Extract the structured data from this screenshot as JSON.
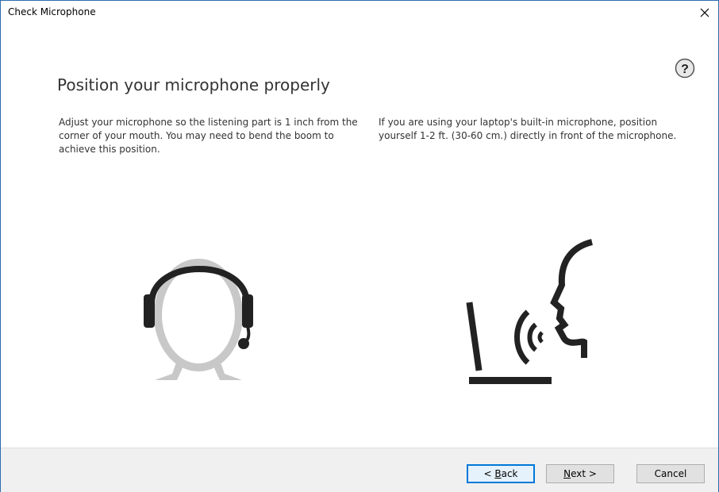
{
  "window": {
    "title": "Check Microphone",
    "close_glyph": "✕"
  },
  "help": {
    "glyph": "?",
    "icon": "help-icon"
  },
  "content": {
    "heading": "Position your microphone properly",
    "left_text": "Adjust your microphone so the listening part is 1 inch from the corner of your mouth. You may need to bend the boom to achieve this position.",
    "right_text": "If you are using your laptop's built-in microphone, position yourself 1-2 ft. (30-60 cm.) directly in front of the microphone."
  },
  "illustrations": {
    "left_icon": "headset-person-icon",
    "right_icon": "laptop-speaking-icon"
  },
  "buttons": {
    "back": {
      "prefix": "< ",
      "accel": "B",
      "rest": "ack"
    },
    "next": {
      "accel": "N",
      "rest": "ext >"
    },
    "cancel": "Cancel"
  },
  "colors": {
    "accent": "#0078d7",
    "icon_dark": "#222222",
    "icon_gray": "#c8c8c8",
    "footer_bg": "#f0f0f0"
  }
}
